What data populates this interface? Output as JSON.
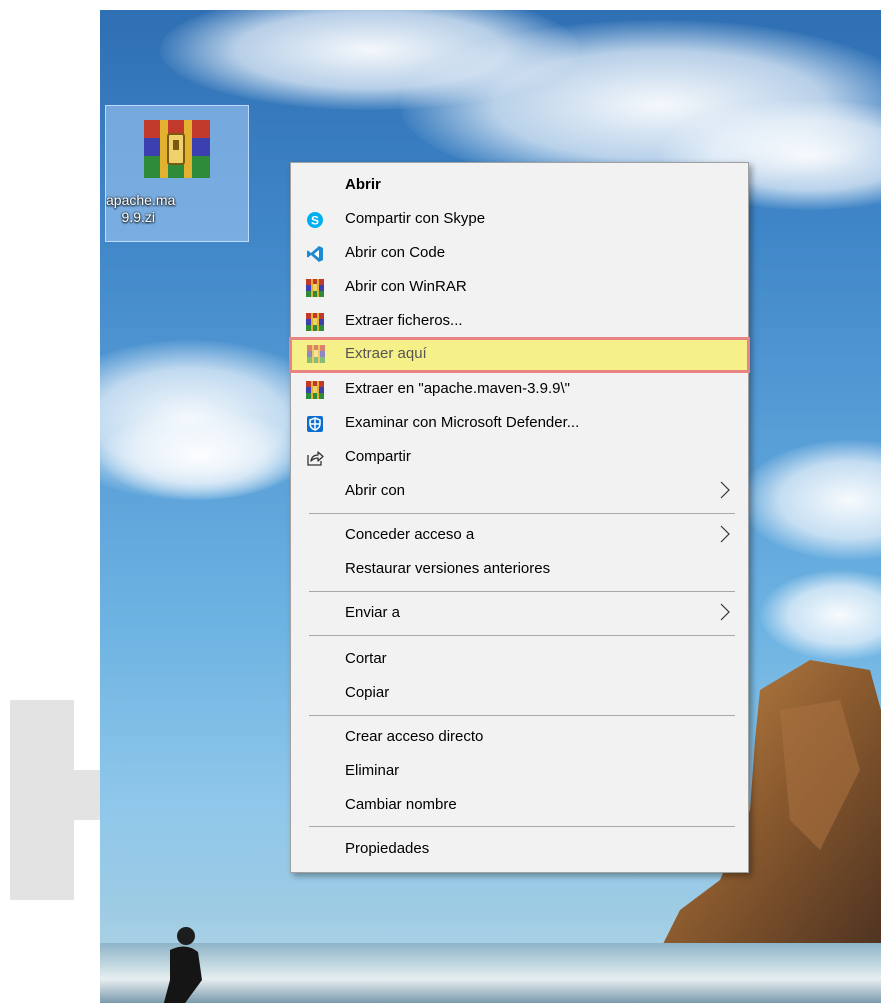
{
  "desktop": {
    "file_icon": {
      "icon": "winrar-archive-icon",
      "label": "apache.ma\n    9.9.zi"
    }
  },
  "context_menu": {
    "items": [
      {
        "label": "Abrir",
        "icon": "",
        "bold": true
      },
      {
        "label": "Compartir con Skype",
        "icon": "skype-icon"
      },
      {
        "label": "Abrir con Code",
        "icon": "vscode-icon"
      },
      {
        "label": "Abrir con WinRAR",
        "icon": "winrar-icon"
      },
      {
        "label": "Extraer ficheros...",
        "icon": "winrar-icon"
      },
      {
        "label": "Extraer aquí",
        "icon": "winrar-icon",
        "highlighted": true
      },
      {
        "label": "Extraer en \"apache.maven-3.9.9\\\"",
        "icon": "winrar-icon"
      },
      {
        "label": "Examinar con Microsoft Defender...",
        "icon": "defender-shield-icon"
      },
      {
        "label": "Compartir",
        "icon": "share-icon"
      },
      {
        "label": "Abrir con",
        "icon": "",
        "submenu": true
      },
      {
        "label": "Conceder acceso a",
        "icon": "",
        "submenu": true
      },
      {
        "label": "Restaurar versiones anteriores",
        "icon": ""
      },
      {
        "label": "Enviar a",
        "icon": "",
        "submenu": true
      },
      {
        "label": "Cortar",
        "icon": ""
      },
      {
        "label": "Copiar",
        "icon": ""
      },
      {
        "label": "Crear acceso directo",
        "icon": ""
      },
      {
        "label": "Eliminar",
        "icon": ""
      },
      {
        "label": "Cambiar nombre",
        "icon": ""
      },
      {
        "label": "Propiedades",
        "icon": ""
      }
    ]
  },
  "colors": {
    "highlight_fill": "#f6f089",
    "highlight_border": "#e98384",
    "menu_background": "#f2f2f2"
  }
}
